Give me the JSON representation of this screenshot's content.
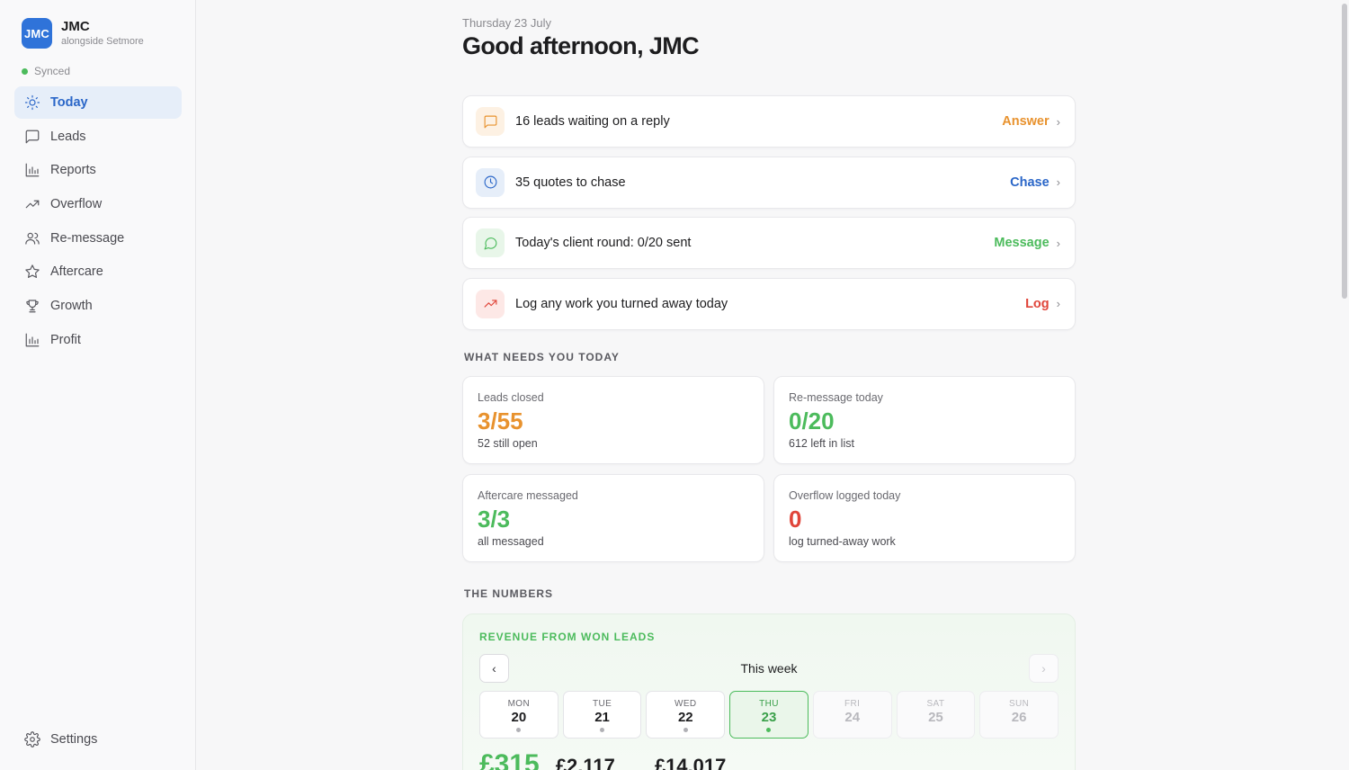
{
  "brand": {
    "logo_text": "JMC",
    "name": "JMC",
    "subtitle": "alongside Setmore"
  },
  "sync_status": "Synced",
  "sidebar": {
    "items": [
      {
        "label": "Today",
        "icon": "sun-icon",
        "active": true
      },
      {
        "label": "Leads",
        "icon": "message-square-icon"
      },
      {
        "label": "Reports",
        "icon": "bar-chart-icon"
      },
      {
        "label": "Overflow",
        "icon": "trending-up-icon"
      },
      {
        "label": "Re-message",
        "icon": "users-icon"
      },
      {
        "label": "Aftercare",
        "icon": "star-icon"
      },
      {
        "label": "Growth",
        "icon": "trophy-icon"
      },
      {
        "label": "Profit",
        "icon": "bar-chart-icon"
      }
    ],
    "settings_label": "Settings"
  },
  "header": {
    "date": "Thursday 23 July",
    "greeting": "Good afternoon, JMC"
  },
  "actions": [
    {
      "text": "16 leads waiting on a reply",
      "link": "Answer",
      "icon": "message-square-icon",
      "color": "#e8922e",
      "bg": "#fdf1e3"
    },
    {
      "text": "35 quotes to chase",
      "link": "Chase",
      "icon": "clock-icon",
      "color": "#2a66c8",
      "bg": "#e6eef9"
    },
    {
      "text": "Today's client round: 0/20 sent",
      "link": "Message",
      "icon": "message-circle-icon",
      "color": "#4cbb5c",
      "bg": "#e8f6e9"
    },
    {
      "text": "Log any work you turned away today",
      "link": "Log",
      "icon": "trending-up-icon",
      "color": "#e0453a",
      "bg": "#fde8e6"
    }
  ],
  "sections": {
    "needs_today": "WHAT NEEDS YOU TODAY",
    "numbers": "THE NUMBERS"
  },
  "stats": [
    {
      "label": "Leads closed",
      "value": "3/55",
      "sub": "52 still open",
      "color": "#e8922e"
    },
    {
      "label": "Re-message today",
      "value": "0/20",
      "sub": "612 left in list",
      "color": "#4cbb5c"
    },
    {
      "label": "Aftercare messaged",
      "value": "3/3",
      "sub": "all messaged",
      "color": "#4cbb5c"
    },
    {
      "label": "Overflow logged today",
      "value": "0",
      "sub": "log turned-away work",
      "color": "#e0453a"
    }
  ],
  "revenue": {
    "title": "REVENUE FROM WON LEADS",
    "week_label": "This week",
    "prev_icon": "chevron-left-icon",
    "next_icon": "chevron-right-icon",
    "days": [
      {
        "name": "MON",
        "num": "20",
        "state": "past"
      },
      {
        "name": "TUE",
        "num": "21",
        "state": "past"
      },
      {
        "name": "WED",
        "num": "22",
        "state": "past"
      },
      {
        "name": "THU",
        "num": "23",
        "state": "active"
      },
      {
        "name": "FRI",
        "num": "24",
        "state": "future"
      },
      {
        "name": "SAT",
        "num": "25",
        "state": "future"
      },
      {
        "name": "SUN",
        "num": "26",
        "state": "future"
      }
    ],
    "totals": [
      "£315",
      "£2,117",
      "£14,017"
    ]
  }
}
